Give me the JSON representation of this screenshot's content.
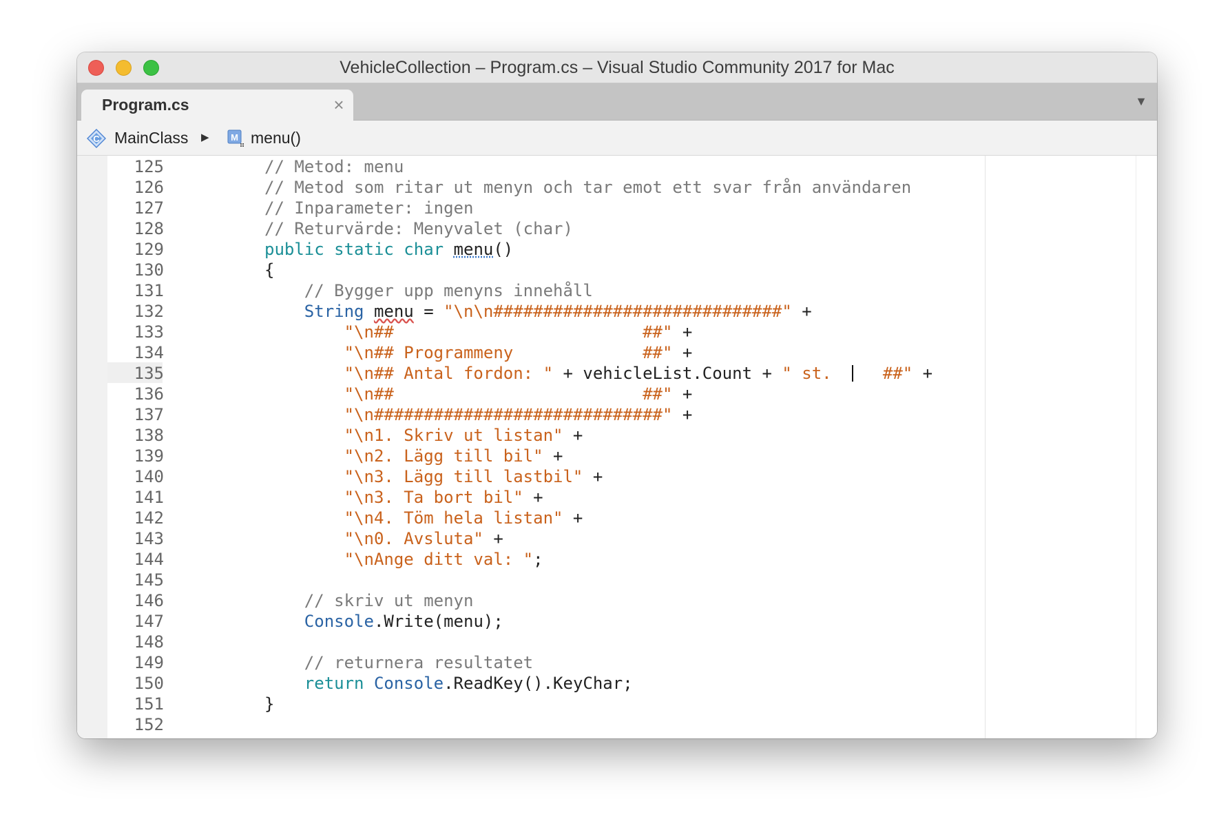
{
  "window": {
    "title": "VehicleCollection – Program.cs – Visual Studio Community 2017 for Mac"
  },
  "tab": {
    "label": "Program.cs",
    "close_glyph": "×",
    "dropdown_glyph": "▼"
  },
  "breadcrumb": {
    "class_icon": "class-icon",
    "class_name": "MainClass",
    "separator": "▶",
    "method_icon": "method-icon",
    "method_name": "menu()"
  },
  "editor": {
    "current_line": 135,
    "colors": {
      "comment": "#7a7a7a",
      "keyword": "#1b8f97",
      "type": "#2a63a4",
      "string": "#c9621c",
      "plain": "#222222"
    },
    "lines": [
      {
        "num": "125",
        "tokens": [
          {
            "t": "// Metod: menu",
            "c": "cm"
          }
        ]
      },
      {
        "num": "126",
        "tokens": [
          {
            "t": "// Metod som ritar ut menyn och tar emot ett svar från användaren",
            "c": "cm"
          }
        ]
      },
      {
        "num": "127",
        "tokens": [
          {
            "t": "// Inparameter: ingen",
            "c": "cm"
          }
        ]
      },
      {
        "num": "128",
        "tokens": [
          {
            "t": "// Returvärde: Menyvalet (char)",
            "c": "cm"
          }
        ]
      },
      {
        "num": "129",
        "tokens": [
          {
            "t": "public static char ",
            "c": "kw"
          },
          {
            "t": "menu",
            "c": "pl",
            "u": "sq-blue"
          },
          {
            "t": "()",
            "c": "pl"
          }
        ]
      },
      {
        "num": "130",
        "tokens": [
          {
            "t": "{",
            "c": "pl"
          }
        ]
      },
      {
        "num": "131",
        "tokens": [
          {
            "t": "    // Bygger upp menyns innehåll",
            "c": "cm"
          }
        ]
      },
      {
        "num": "132",
        "tokens": [
          {
            "t": "    ",
            "c": "pl"
          },
          {
            "t": "String",
            "c": "ty"
          },
          {
            "t": " ",
            "c": "pl"
          },
          {
            "t": "menu",
            "c": "pl",
            "u": "sq-red"
          },
          {
            "t": " = ",
            "c": "pl"
          },
          {
            "t": "\"\\n\\n#############################\"",
            "c": "st"
          },
          {
            "t": " +",
            "c": "pl"
          }
        ]
      },
      {
        "num": "133",
        "tokens": [
          {
            "t": "        ",
            "c": "pl"
          },
          {
            "t": "\"\\n##                         ##\"",
            "c": "st"
          },
          {
            "t": " +",
            "c": "pl"
          }
        ]
      },
      {
        "num": "134",
        "tokens": [
          {
            "t": "        ",
            "c": "pl"
          },
          {
            "t": "\"\\n## Programmeny             ##\"",
            "c": "st"
          },
          {
            "t": " +",
            "c": "pl"
          }
        ]
      },
      {
        "num": "135",
        "tokens": [
          {
            "t": "        ",
            "c": "pl"
          },
          {
            "t": "\"\\n## Antal fordon: \"",
            "c": "st"
          },
          {
            "t": " + vehicleList.Count + ",
            "c": "pl"
          },
          {
            "t": "\" st.  ",
            "c": "st"
          },
          {
            "caret": true
          },
          {
            "t": "   ##\"",
            "c": "st"
          },
          {
            "t": " +",
            "c": "pl"
          }
        ]
      },
      {
        "num": "136",
        "tokens": [
          {
            "t": "        ",
            "c": "pl"
          },
          {
            "t": "\"\\n##                         ##\"",
            "c": "st"
          },
          {
            "t": " +",
            "c": "pl"
          }
        ]
      },
      {
        "num": "137",
        "tokens": [
          {
            "t": "        ",
            "c": "pl"
          },
          {
            "t": "\"\\n#############################\"",
            "c": "st"
          },
          {
            "t": " +",
            "c": "pl"
          }
        ]
      },
      {
        "num": "138",
        "tokens": [
          {
            "t": "        ",
            "c": "pl"
          },
          {
            "t": "\"\\n1. Skriv ut listan\"",
            "c": "st"
          },
          {
            "t": " +",
            "c": "pl"
          }
        ]
      },
      {
        "num": "139",
        "tokens": [
          {
            "t": "        ",
            "c": "pl"
          },
          {
            "t": "\"\\n2. Lägg till bil\"",
            "c": "st"
          },
          {
            "t": " +",
            "c": "pl"
          }
        ]
      },
      {
        "num": "140",
        "tokens": [
          {
            "t": "        ",
            "c": "pl"
          },
          {
            "t": "\"\\n3. Lägg till lastbil\"",
            "c": "st"
          },
          {
            "t": " +",
            "c": "pl"
          }
        ]
      },
      {
        "num": "141",
        "tokens": [
          {
            "t": "        ",
            "c": "pl"
          },
          {
            "t": "\"\\n3. Ta bort bil\"",
            "c": "st"
          },
          {
            "t": " +",
            "c": "pl"
          }
        ]
      },
      {
        "num": "142",
        "tokens": [
          {
            "t": "        ",
            "c": "pl"
          },
          {
            "t": "\"\\n4. Töm hela listan\"",
            "c": "st"
          },
          {
            "t": " +",
            "c": "pl"
          }
        ]
      },
      {
        "num": "143",
        "tokens": [
          {
            "t": "        ",
            "c": "pl"
          },
          {
            "t": "\"\\n0. Avsluta\"",
            "c": "st"
          },
          {
            "t": " +",
            "c": "pl"
          }
        ]
      },
      {
        "num": "144",
        "tokens": [
          {
            "t": "        ",
            "c": "pl"
          },
          {
            "t": "\"\\nAnge ditt val: \"",
            "c": "st"
          },
          {
            "t": ";",
            "c": "pl"
          }
        ]
      },
      {
        "num": "145",
        "tokens": []
      },
      {
        "num": "146",
        "tokens": [
          {
            "t": "    // skriv ut menyn",
            "c": "cm"
          }
        ]
      },
      {
        "num": "147",
        "tokens": [
          {
            "t": "    ",
            "c": "pl"
          },
          {
            "t": "Console",
            "c": "ty"
          },
          {
            "t": ".Write(menu);",
            "c": "pl"
          }
        ]
      },
      {
        "num": "148",
        "tokens": []
      },
      {
        "num": "149",
        "tokens": [
          {
            "t": "    // returnera resultatet",
            "c": "cm"
          }
        ]
      },
      {
        "num": "150",
        "tokens": [
          {
            "t": "    ",
            "c": "pl"
          },
          {
            "t": "return",
            "c": "kw"
          },
          {
            "t": " ",
            "c": "pl"
          },
          {
            "t": "Console",
            "c": "ty"
          },
          {
            "t": ".ReadKey().KeyChar;",
            "c": "pl"
          }
        ]
      },
      {
        "num": "151",
        "tokens": [
          {
            "t": "}",
            "c": "pl"
          }
        ]
      },
      {
        "num": "152",
        "tokens": []
      }
    ]
  }
}
